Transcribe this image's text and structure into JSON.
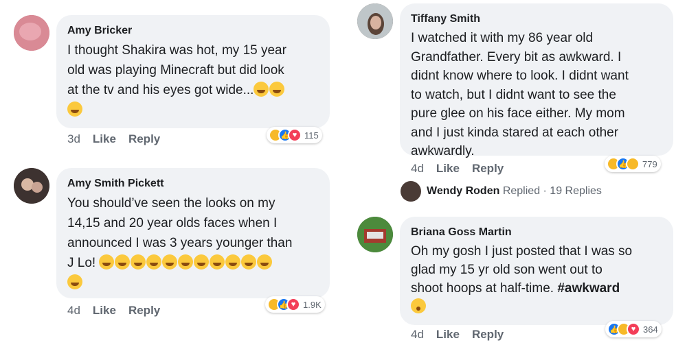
{
  "comments": [
    {
      "author": "Amy Bricker",
      "line1": "I thought Shakira was hot, my 15 year",
      "line2": "old was playing Minecraft but did look",
      "line3": "at the tv and his eyes got wide...",
      "time": "3d",
      "like": "Like",
      "reply": "Reply",
      "reaction_count": "115",
      "avatar_color": "#c96a7a"
    },
    {
      "author": "Amy Smith Pickett",
      "line1": "You should’ve seen the looks on my",
      "line2": "14,15 and 20 year olds faces when I",
      "line3": "announced I was 3 years younger than",
      "line4": "J Lo!",
      "time": "4d",
      "like": "Like",
      "reply": "Reply",
      "reaction_count": "1.9K",
      "avatar_color": "#5a4b47"
    },
    {
      "author": "Tiffany Smith",
      "lines": [
        "I watched it with my 86 year old",
        "Grandfather. Every bit as awkward. I",
        "didnt know where to look. I didnt want",
        "to watch, but I didnt want to see the",
        "pure glee on his face either. My mom",
        "and I just kinda stared at each other",
        "awkwardly."
      ],
      "time": "4d",
      "like": "Like",
      "reply": "Reply",
      "reaction_count": "779",
      "avatar_color": "#7a6f6a"
    },
    {
      "author": "Briana Goss Martin",
      "line1": "Oh my gosh I just posted that I was so",
      "line2": "glad my 15 yr old son went out to",
      "line3": "shoot hoops at half-time.",
      "hashtag": "#awkward",
      "time": "4d",
      "like": "Like",
      "reply": "Reply",
      "reaction_count": "364",
      "avatar_color": "#3f7a3a"
    }
  ],
  "replies": {
    "name": "Wendy Roden",
    "text": "Replied · 19 Replies"
  },
  "colors": {
    "bubble": "#f0f2f5",
    "meta_text": "#606770",
    "like_blue": "#1877f2",
    "love_red": "#f33e58",
    "haha_yellow": "#f7b928"
  }
}
